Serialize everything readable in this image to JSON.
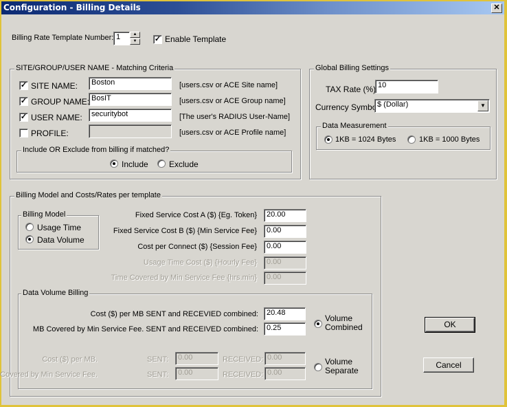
{
  "window": {
    "title": "Configuration - Billing Details",
    "close_icon": "close-icon"
  },
  "template": {
    "number_label": "Billing Rate Template Number:",
    "number_value": "1",
    "enable_label": "Enable Template",
    "enable_checked": true
  },
  "matching": {
    "legend": "SITE/GROUP/USER NAME - Matching Criteria",
    "rows": [
      {
        "label": "SITE NAME:",
        "checked": true,
        "value": "Boston",
        "hint": "[users.csv or ACE Site name]",
        "enabled": true
      },
      {
        "label": "GROUP NAME:",
        "checked": true,
        "value": "BosIT",
        "hint": "[users.csv or ACE Group name]",
        "enabled": true
      },
      {
        "label": "USER NAME:",
        "checked": true,
        "value": "securitybot",
        "hint": "[The user's RADIUS User-Name]",
        "enabled": true
      },
      {
        "label": "PROFILE:",
        "checked": false,
        "value": "",
        "hint": "[users.csv or ACE Profile name]",
        "enabled": false
      }
    ],
    "include_group": {
      "legend": "Include OR Exclude from billing if matched?",
      "options": [
        "Include",
        "Exclude"
      ],
      "selected": "Include"
    }
  },
  "global": {
    "legend": "Global Billing Settings",
    "tax_label": "TAX Rate (%)",
    "tax_value": "10",
    "currency_label": "Currency Symbol",
    "currency_value": "$ (Dollar)",
    "data_measurement": {
      "legend": "Data Measurement",
      "options": [
        "1KB = 1024 Bytes",
        "1KB = 1000 Bytes"
      ],
      "selected": "1KB = 1024 Bytes"
    }
  },
  "model": {
    "legend": "Billing Model and Costs/Rates per template",
    "billing_model": {
      "legend": "Billing Model",
      "options": [
        "Usage Time",
        "Data Volume"
      ],
      "selected": "Data Volume"
    },
    "costs": [
      {
        "label": "Fixed Service Cost A ($) {Eg. Token}",
        "value": "20.00",
        "enabled": true
      },
      {
        "label": "Fixed Service Cost B ($) {Min Service Fee}",
        "value": "0.00",
        "enabled": true
      },
      {
        "label": "Cost per Connect ($) {Session Fee}",
        "value": "0.00",
        "enabled": true
      },
      {
        "label": "Usage Time Cost ($) {Hourly Fee}",
        "value": "0.00",
        "enabled": false
      },
      {
        "label": "Time Covered by Min Service Fee {hrs.min}",
        "value": "0.00",
        "enabled": false
      }
    ],
    "data_volume": {
      "legend": "Data Volume Billing",
      "combined_cost_label": "Cost ($) per MB SENT and RECEVIED combined:",
      "combined_cost_value": "20.48",
      "combined_mb_label": "MB Covered by Min Service Fee. SENT and RECEIVED combined:",
      "combined_mb_value": "0.25",
      "combined_radio_label": "Volume Combined",
      "combined_selected": true,
      "separate_cost_label": "Cost ($) per MB.",
      "separate_mb_label": "MB Covered by Min Service Fee.",
      "sent_label": "SENT:",
      "received_label": "RECEIVED:",
      "sep_cost_sent": "0.00",
      "sep_cost_received": "0.00",
      "sep_mb_sent": "0.00",
      "sep_mb_received": "0.00",
      "separate_radio_label": "Volume Separate",
      "separate_selected": false
    }
  },
  "buttons": {
    "ok": "OK",
    "cancel": "Cancel"
  }
}
